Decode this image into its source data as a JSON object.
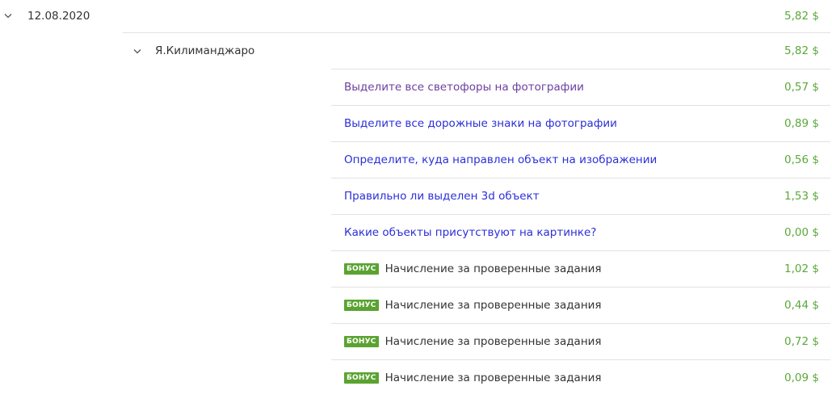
{
  "date_group": {
    "date": "12.08.2020",
    "total": "5,82 $"
  },
  "project_group": {
    "name": "Я.Килиманджаро",
    "total": "5,82 $"
  },
  "tasks": [
    {
      "title": "Выделите все светофоры на фотографии",
      "amount": "0,57 $",
      "visited": true
    },
    {
      "title": "Выделите все дорожные знаки на фотографии",
      "amount": "0,89 $",
      "visited": false
    },
    {
      "title": "Определите, куда направлен объект на изображении",
      "amount": "0,56 $",
      "visited": false
    },
    {
      "title": "Правильно ли выделен 3d объект",
      "amount": "1,53 $",
      "visited": false
    },
    {
      "title": "Какие объекты присутствуют на картинке?",
      "amount": "0,00 $",
      "visited": false
    }
  ],
  "bonuses": [
    {
      "badge": "БОНУС",
      "title": "Начисление за проверенные задания",
      "amount": "1,02 $"
    },
    {
      "badge": "БОНУС",
      "title": "Начисление за проверенные задания",
      "amount": "0,44 $"
    },
    {
      "badge": "БОНУС",
      "title": "Начисление за проверенные задания",
      "amount": "0,72 $"
    },
    {
      "badge": "БОНУС",
      "title": "Начисление за проверенные задания",
      "amount": "0,09 $"
    }
  ],
  "colors": {
    "amount": "#5aa83a",
    "link": "#2b2fd8",
    "link_visited": "#6b3fa0",
    "bonus_badge": "#5ba331",
    "divider": "#e2e2e2"
  },
  "icons": {
    "expand": "chevron-down-icon"
  }
}
